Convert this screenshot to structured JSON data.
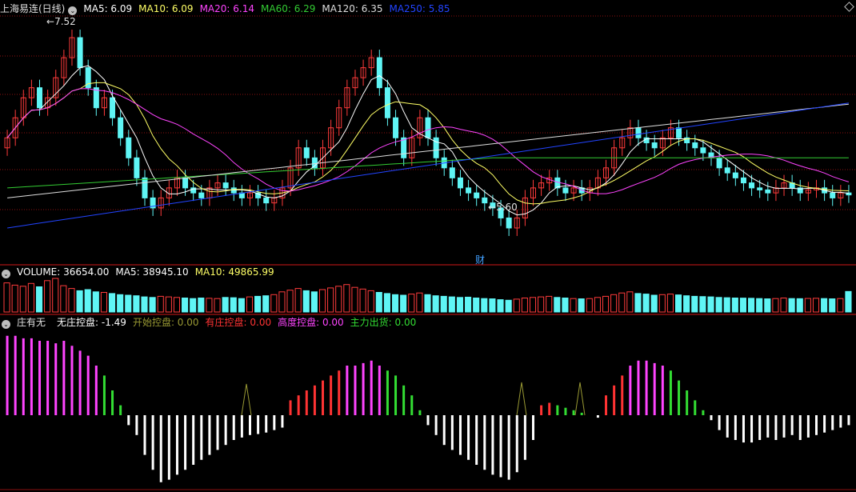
{
  "main_panel": {
    "stock": "上海易连(日线)",
    "ma_labels": [
      {
        "text": "MA5: 6.09",
        "color": "#ffffff"
      },
      {
        "text": "MA10: 6.09",
        "color": "#ffff66"
      },
      {
        "text": "MA20: 6.14",
        "color": "#ff44ff"
      },
      {
        "text": "MA60: 6.29",
        "color": "#33cc33"
      },
      {
        "text": "MA120: 6.35",
        "color": "#dddddd"
      },
      {
        "text": "MA250: 5.85",
        "color": "#2244ff"
      }
    ],
    "high_label": "7.52",
    "low_label": "5.60",
    "finance_marker": "财"
  },
  "volume_panel": {
    "labels": [
      {
        "text": "VOLUME: 36654.00",
        "color": "#ffffff"
      },
      {
        "text": "MA5: 38945.10",
        "color": "#ffffff"
      },
      {
        "text": "MA10: 49865.99",
        "color": "#ffff66"
      }
    ]
  },
  "indicator_panel": {
    "name": "庄有无",
    "labels": [
      {
        "text": "无庄控盘: -1.49",
        "color": "#ffffff"
      },
      {
        "text": "开始控盘: 0.00",
        "color": "#999933"
      },
      {
        "text": "有庄控盘: 0.00",
        "color": "#ff3333"
      },
      {
        "text": "高度控盘: 0.00",
        "color": "#ff44ff"
      },
      {
        "text": "主力出货: 0.00",
        "color": "#33dd33"
      }
    ]
  },
  "colors": {
    "up": "#ff3b3b",
    "down": "#5ff5f5",
    "grid": "#8b1010",
    "background": "#000000"
  },
  "icons": {
    "collapse": "chevron-down-icon",
    "corner": "diamond-icon"
  },
  "chart_data": {
    "type": "candlestick",
    "price": {
      "ylim": [
        5.4,
        7.7
      ],
      "closes": [
        6.5,
        6.7,
        6.9,
        7.0,
        6.8,
        6.9,
        7.1,
        7.3,
        7.5,
        7.2,
        7.0,
        6.8,
        6.9,
        6.7,
        6.5,
        6.3,
        6.1,
        5.9,
        5.8,
        5.9,
        6.0,
        6.1,
        6.0,
        5.95,
        5.9,
        6.0,
        6.05,
        6.0,
        5.95,
        5.9,
        5.95,
        5.9,
        5.85,
        5.9,
        6.0,
        6.2,
        6.4,
        6.3,
        6.2,
        6.4,
        6.6,
        6.8,
        7.0,
        7.1,
        7.2,
        7.3,
        7.0,
        6.7,
        6.5,
        6.3,
        6.5,
        6.7,
        6.5,
        6.3,
        6.2,
        6.1,
        6.0,
        5.95,
        5.9,
        5.85,
        5.8,
        5.7,
        5.6,
        5.7,
        5.9,
        6.0,
        6.05,
        6.1,
        6.0,
        5.95,
        6.0,
        5.95,
        6.0,
        6.1,
        6.2,
        6.4,
        6.5,
        6.6,
        6.5,
        6.45,
        6.4,
        6.5,
        6.6,
        6.5,
        6.45,
        6.4,
        6.35,
        6.3,
        6.2,
        6.15,
        6.1,
        6.05,
        6.0,
        5.98,
        5.95,
        6.0,
        6.05,
        6.0,
        5.95,
        5.98,
        6.0,
        5.95,
        5.9,
        5.95,
        5.93
      ],
      "ma": [
        {
          "name": "MA5",
          "color": "#ffffff",
          "window": 5
        },
        {
          "name": "MA10",
          "color": "#ffff66",
          "window": 10
        },
        {
          "name": "MA20",
          "color": "#ff44ff",
          "window": 20
        },
        {
          "name": "MA60",
          "color": "#33cc33",
          "window": 60
        },
        {
          "name": "MA120",
          "color": "#dddddd",
          "window": 120
        },
        {
          "name": "MA250",
          "color": "#2244ff",
          "window": 250
        }
      ]
    },
    "volume": {
      "values": [
        52000,
        48000,
        46000,
        51000,
        45000,
        56000,
        60000,
        47000,
        42000,
        38000,
        40000,
        36000,
        35000,
        33000,
        31000,
        30000,
        29000,
        27000,
        26000,
        28000,
        27000,
        26000,
        25000,
        24000,
        25000,
        24500,
        24000,
        26000,
        25500,
        24000,
        27000,
        28000,
        29000,
        31000,
        36000,
        39000,
        42000,
        38000,
        36000,
        40000,
        43000,
        46000,
        49000,
        44000,
        41000,
        38000,
        35000,
        33000,
        31000,
        30000,
        32000,
        34000,
        31000,
        29000,
        28000,
        27000,
        26000,
        26500,
        25000,
        24000,
        23500,
        22000,
        21000,
        23000,
        25000,
        26000,
        27000,
        28000,
        26000,
        25000,
        24000,
        23500,
        24000,
        26000,
        28000,
        31000,
        34000,
        36000,
        33000,
        32000,
        30000,
        31000,
        32000,
        30500,
        29000,
        28000,
        27500,
        27000,
        26000,
        25500,
        25000,
        24800,
        24500,
        24000,
        23500,
        24000,
        25000,
        24000,
        23800,
        24200,
        24500,
        24000,
        23500,
        24000,
        36654
      ]
    },
    "indicator": {
      "ylim": [
        -1.5,
        1.5
      ],
      "values": [
        1.6,
        1.6,
        1.55,
        1.55,
        1.5,
        1.5,
        1.45,
        1.5,
        1.4,
        1.3,
        1.2,
        1.0,
        0.8,
        0.5,
        0.2,
        -0.2,
        -0.4,
        -0.8,
        -1.1,
        -1.35,
        -1.3,
        -1.2,
        -1.1,
        -1.0,
        -0.9,
        -0.8,
        -0.7,
        -0.6,
        -0.5,
        -0.45,
        -0.4,
        -0.38,
        -0.35,
        -0.3,
        -0.25,
        0.3,
        0.4,
        0.5,
        0.6,
        0.7,
        0.8,
        0.9,
        1.0,
        1.0,
        1.05,
        1.1,
        1.0,
        0.9,
        0.8,
        0.6,
        0.4,
        0.1,
        -0.2,
        -0.4,
        -0.6,
        -0.7,
        -0.8,
        -0.9,
        -1.0,
        -1.1,
        -1.2,
        -1.25,
        -1.3,
        -1.15,
        -0.9,
        -0.5,
        0.2,
        0.25,
        0.2,
        0.15,
        0.1,
        0.05,
        0.0,
        -0.05,
        0.4,
        0.6,
        0.8,
        1.0,
        1.1,
        1.1,
        1.05,
        1.0,
        0.9,
        0.7,
        0.5,
        0.3,
        0.1,
        -0.1,
        -0.3,
        -0.45,
        -0.5,
        -0.55,
        -0.55,
        -0.5,
        -0.45,
        -0.5,
        -0.45,
        -0.4,
        -0.5,
        -0.45,
        -0.4,
        -0.35,
        -0.3,
        -0.25,
        -0.2
      ],
      "series": [
        {
          "name": "无庄控盘",
          "color": "#ffffff"
        },
        {
          "name": "开始控盘",
          "color": "#999933"
        },
        {
          "name": "有庄控盘",
          "color": "#ff3333"
        },
        {
          "name": "高度控盘",
          "color": "#ff44ff"
        },
        {
          "name": "主力出货",
          "color": "#33dd33"
        }
      ]
    }
  }
}
